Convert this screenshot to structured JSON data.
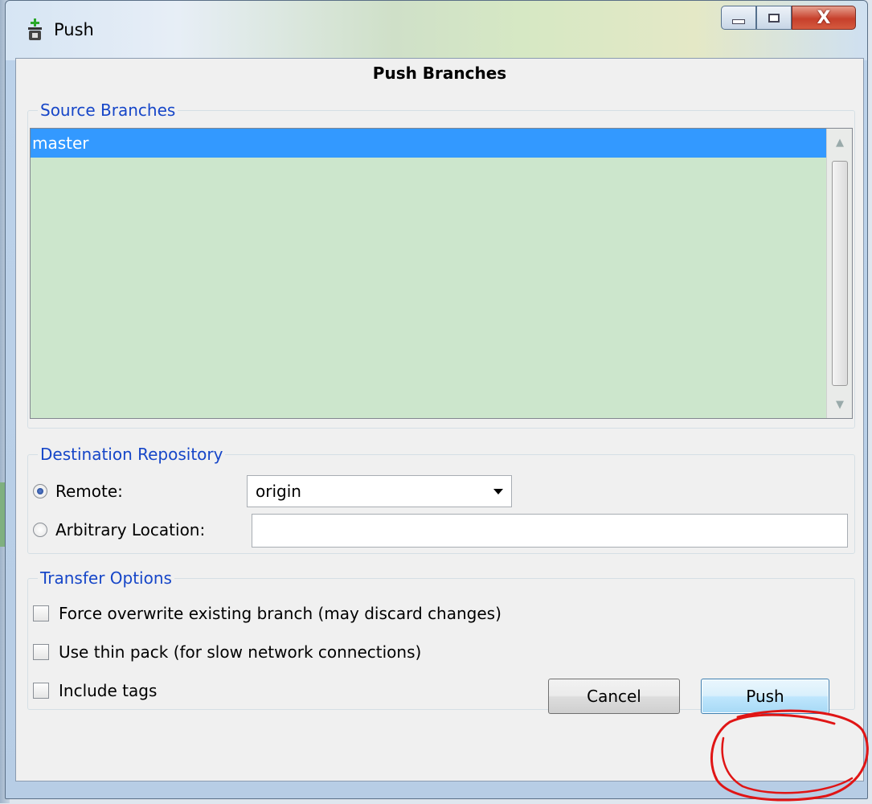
{
  "window": {
    "title": "Push",
    "controls": {
      "minimize": "minimize",
      "maximize": "maximize",
      "close": "X"
    }
  },
  "dialog": {
    "heading": "Push Branches"
  },
  "source_branches": {
    "legend": "Source Branches",
    "items": [
      {
        "label": "master",
        "selected": true
      }
    ]
  },
  "destination": {
    "legend": "Destination Repository",
    "remote_label": "Remote:",
    "remote_value": "origin",
    "remote_selected": true,
    "arbitrary_label": "Arbitrary Location:",
    "arbitrary_value": ""
  },
  "transfer": {
    "legend": "Transfer Options",
    "options": [
      {
        "label": "Force overwrite existing branch (may discard changes)",
        "checked": false
      },
      {
        "label": "Use thin pack (for slow network connections)",
        "checked": false
      },
      {
        "label": "Include tags",
        "checked": false
      }
    ]
  },
  "buttons": {
    "cancel": "Cancel",
    "push": "Push"
  },
  "colors": {
    "selection": "#3399ff",
    "list_background": "#cce6cc",
    "legend_text": "#1646c8",
    "annotation_circle": "#e01515"
  }
}
